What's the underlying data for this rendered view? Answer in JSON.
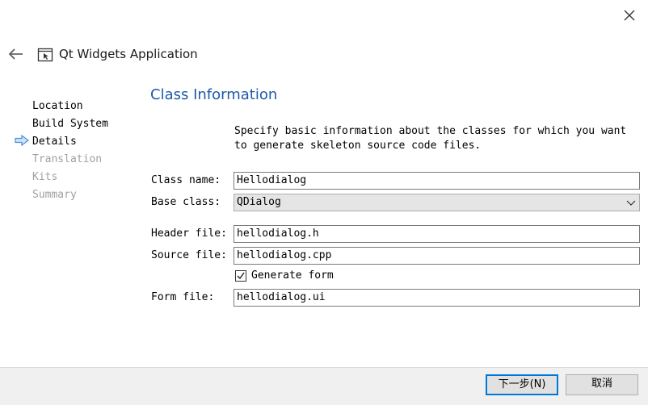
{
  "header": {
    "title": "Qt Widgets Application",
    "back_icon": "back-arrow-icon",
    "app_icon": "qt-widgets-app-icon",
    "close_icon": "close-icon"
  },
  "steps": [
    {
      "label": "Location",
      "state": "done"
    },
    {
      "label": "Build System",
      "state": "done"
    },
    {
      "label": "Details",
      "state": "current"
    },
    {
      "label": "Translation",
      "state": "pending"
    },
    {
      "label": "Kits",
      "state": "pending"
    },
    {
      "label": "Summary",
      "state": "pending"
    }
  ],
  "main": {
    "section_title": "Class Information",
    "description": "Specify basic information about the classes for which you want to generate skeleton source code files.",
    "fields": {
      "class_name": {
        "label": "Class name:",
        "value": "Hellodialog"
      },
      "base_class": {
        "label": "Base class:",
        "value": "QDialog"
      },
      "header_file": {
        "label": "Header file:",
        "value": "hellodialog.h"
      },
      "source_file": {
        "label": "Source file:",
        "value": "hellodialog.cpp"
      },
      "generate_form": {
        "label": "Generate form",
        "checked": true
      },
      "form_file": {
        "label": "Form file:",
        "value": "hellodialog.ui"
      }
    }
  },
  "footer": {
    "next_label": "下一步(N)",
    "cancel_label": "取消"
  },
  "colors": {
    "accent": "#1e5aa8",
    "arrow": "#4a90d9",
    "pending_text": "#a0a0a0",
    "default_button_border": "#0078d7"
  }
}
